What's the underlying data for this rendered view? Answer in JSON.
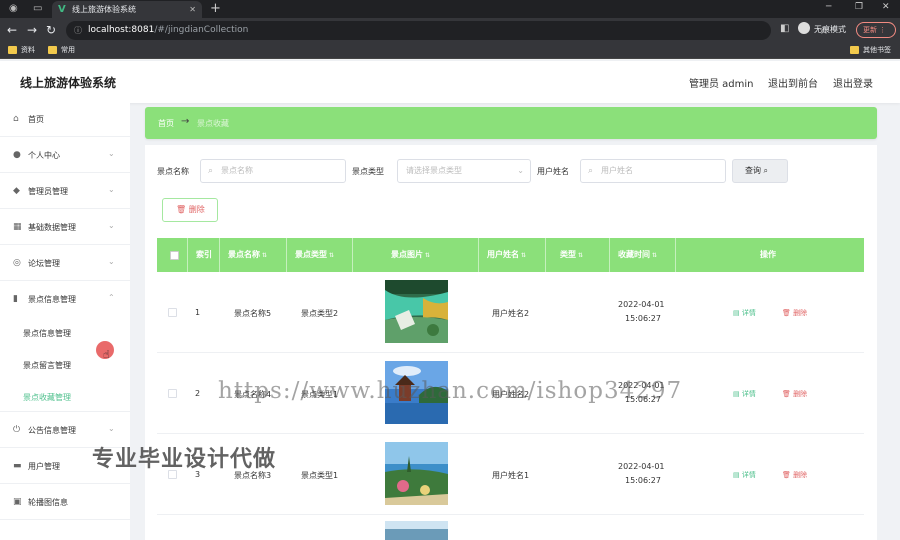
{
  "browser": {
    "tab_title": "线上旅游体验系统",
    "address_host": "localhost:8081",
    "address_path": "/#/jingdianCollection",
    "incognito_label": "无痕模式",
    "update_label": "更新",
    "bookmarks": [
      "资料",
      "常用"
    ],
    "other_bookmarks": "其他书签"
  },
  "header": {
    "app_title": "线上旅游体验系统",
    "admin_label": "管理员 admin",
    "front_label": "退出到前台",
    "logout_label": "退出登录"
  },
  "sidebar": {
    "items": [
      {
        "label": "首页",
        "icon": "home-icon"
      },
      {
        "label": "个人中心",
        "icon": "user-icon"
      },
      {
        "label": "管理员管理",
        "icon": "shield-icon"
      },
      {
        "label": "基础数据管理",
        "icon": "grid-icon"
      },
      {
        "label": "论坛管理",
        "icon": "globe-icon"
      },
      {
        "label": "景点信息管理",
        "icon": "chart-icon"
      },
      {
        "label": "公告信息管理",
        "icon": "power-icon"
      },
      {
        "label": "用户管理",
        "icon": "user-box-icon"
      },
      {
        "label": "轮播图信息",
        "icon": "image-icon"
      }
    ],
    "sub_items": [
      "景点信息管理",
      "景点留言管理",
      "景点收藏管理"
    ]
  },
  "breadcrumb": {
    "home": "首页",
    "separator": "→",
    "current": "景点收藏"
  },
  "filters": {
    "name_label": "景点名称",
    "name_placeholder": "景点名称",
    "type_label": "景点类型",
    "type_placeholder": "请选择景点类型",
    "user_label": "用户姓名",
    "user_placeholder": "用户姓名",
    "query_label": "查询",
    "delete_label": "删除"
  },
  "table": {
    "columns": [
      "索引",
      "景点名称",
      "景点类型",
      "景点图片",
      "用户姓名",
      "类型",
      "收藏时间",
      "操作"
    ],
    "rows": [
      {
        "index": "1",
        "name": "景点名称5",
        "type": "景点类型2",
        "user": "用户姓名2",
        "date": "2022-04-01",
        "time": "15:06:27"
      },
      {
        "index": "2",
        "name": "景点名称4",
        "type": "景点类型1",
        "user": "用户姓名2",
        "date": "2022-04-01",
        "time": "15:06:27"
      },
      {
        "index": "3",
        "name": "景点名称3",
        "type": "景点类型1",
        "user": "用户姓名1",
        "date": "2022-04-01",
        "time": "15:06:27"
      }
    ],
    "detail_label": "详情",
    "delete_label": "删除"
  },
  "overlay": {
    "watermark": "https://www.huzhan.com/ishop34297",
    "promo": "专业毕业设计代做"
  },
  "colors": {
    "accent": "#8be07a",
    "active": "#4fc08d",
    "danger": "#e06363"
  }
}
